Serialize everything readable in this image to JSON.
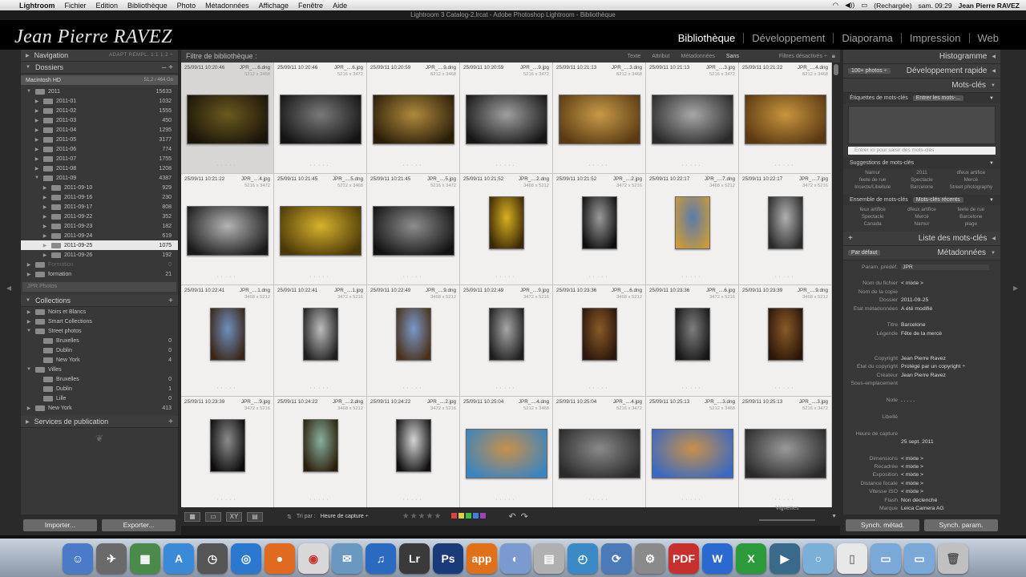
{
  "menubar": {
    "app": "Lightroom",
    "items": [
      "Fichier",
      "Edition",
      "Bibliothèque",
      "Photo",
      "Métadonnées",
      "Affichage",
      "Fenêtre",
      "Aide"
    ],
    "battery": "(Rechargée)",
    "clock": "sam. 09:29",
    "user": "Jean Pierre RAVEZ"
  },
  "window_title": "Lightroom 3 Catalog-2.lrcat - Adobe Photoshop Lightroom - Bibliothèque",
  "identity_plate": "Jean Pierre RAVEZ",
  "modules": [
    "Bibliothèque",
    "Développement",
    "Diaporama",
    "Impression",
    "Web"
  ],
  "left": {
    "navigation": {
      "title": "Navigation",
      "zoom": "ADAPT  REMPL.  1:1  1:2 ÷"
    },
    "dossiers": {
      "title": "Dossiers",
      "volume": {
        "name": "Macintosh HD",
        "size": "51,2 / 464 Go"
      },
      "folders": [
        {
          "name": "2011",
          "count": "15633",
          "level": 1,
          "open": true
        },
        {
          "name": "2011-01",
          "count": "1032",
          "level": 2
        },
        {
          "name": "2011-02",
          "count": "1555",
          "level": 2
        },
        {
          "name": "2011-03",
          "count": "450",
          "level": 2
        },
        {
          "name": "2011-04",
          "count": "1295",
          "level": 2
        },
        {
          "name": "2011-05",
          "count": "3177",
          "level": 2
        },
        {
          "name": "2011-06",
          "count": "774",
          "level": 2
        },
        {
          "name": "2011-07",
          "count": "1755",
          "level": 2
        },
        {
          "name": "2011-08",
          "count": "1208",
          "level": 2
        },
        {
          "name": "2011-09",
          "count": "4387",
          "level": 2,
          "open": true
        },
        {
          "name": "2011-09-10",
          "count": "929",
          "level": 3
        },
        {
          "name": "2011-09-16",
          "count": "230",
          "level": 3
        },
        {
          "name": "2011-09-17",
          "count": "808",
          "level": 3
        },
        {
          "name": "2011-09-22",
          "count": "352",
          "level": 3
        },
        {
          "name": "2011-09-23",
          "count": "182",
          "level": 3
        },
        {
          "name": "2011-09-24",
          "count": "619",
          "level": 3
        },
        {
          "name": "2011-09-25",
          "count": "1075",
          "level": 3,
          "selected": true
        },
        {
          "name": "2011-09-26",
          "count": "192",
          "level": 3
        },
        {
          "name": "Formation",
          "count": "0",
          "level": 1,
          "dim": true
        },
        {
          "name": "formation",
          "count": "21",
          "level": 1
        }
      ],
      "jpr": "JPR Photos"
    },
    "collections": {
      "title": "Collections",
      "items": [
        {
          "name": "Noirs et Blancs",
          "count": "",
          "level": 1
        },
        {
          "name": "Smart Collections",
          "count": "",
          "level": 1
        },
        {
          "name": "Street photos",
          "count": "",
          "level": 1,
          "open": true
        },
        {
          "name": "Bruxelles",
          "count": "0",
          "level": 2
        },
        {
          "name": "Dublin",
          "count": "0",
          "level": 2
        },
        {
          "name": "New York",
          "count": "4",
          "level": 2
        },
        {
          "name": "Villes",
          "count": "",
          "level": 1,
          "open": true
        },
        {
          "name": "Bruxelles",
          "count": "0",
          "level": 2
        },
        {
          "name": "Dublin",
          "count": "1",
          "level": 2
        },
        {
          "name": "Lille",
          "count": "0",
          "level": 2
        },
        {
          "name": "New York",
          "count": "413",
          "level": 1
        }
      ]
    },
    "publish": {
      "title": "Services de publication"
    },
    "import_label": "Importer...",
    "export_label": "Exporter..."
  },
  "filterbar": {
    "title": "Filtre de bibliothèque :",
    "options": [
      "Texte",
      "Attribut",
      "Métadonnées",
      "Sans"
    ],
    "status": "Filtres désactivés ÷"
  },
  "grid": [
    {
      "date": "25/09/11 10:20:46",
      "name": "JPR_....6.dng",
      "dims": "3472 x 5216",
      "fmt": "5212 x 3468",
      "c1": "#6b5a1e",
      "c2": "#1a140a",
      "portrait": false
    },
    {
      "date": "25/09/11 10:20:46",
      "name": "JPR_....6.jpg",
      "dims": "",
      "fmt": "5216 x 3472",
      "c1": "#7a7a7a",
      "c2": "#141414",
      "portrait": false
    },
    {
      "date": "25/09/11 10:20:59",
      "name": "JPR_....9.dng",
      "dims": "",
      "fmt": "5212 x 3468",
      "c1": "#b08a3c",
      "c2": "#2a1e0a",
      "portrait": false
    },
    {
      "date": "25/09/11 10:20:59",
      "name": "JPR_....9.jpg",
      "dims": "",
      "fmt": "5216 x 3472",
      "c1": "#a0a0a0",
      "c2": "#161616",
      "portrait": false
    },
    {
      "date": "25/09/11 10:21:13",
      "name": "JPR_....3.dng",
      "dims": "",
      "fmt": "5212 x 3468",
      "c1": "#c89a48",
      "c2": "#5a3a14",
      "portrait": false
    },
    {
      "date": "25/09/11 10:21:13",
      "name": "JPR_....3.jpg",
      "dims": "",
      "fmt": "5216 x 3472",
      "c1": "#a8a8a8",
      "c2": "#2a2a2a",
      "portrait": false
    },
    {
      "date": "25/09/11 10:21:22",
      "name": "JPR_....4.dng",
      "dims": "",
      "fmt": "5212 x 3468",
      "c1": "#c8963e",
      "c2": "#5a3812",
      "portrait": false
    },
    {
      "date": "25/09/11 10:21:22",
      "name": "JPR_....4.jpg",
      "dims": "",
      "fmt": "5216 x 3472",
      "c1": "#b4b4b4",
      "c2": "#1a1a1a",
      "portrait": false
    },
    {
      "date": "25/09/11 10:21:45",
      "name": "JPR_....5.dng",
      "dims": "",
      "fmt": "5212 x 3468",
      "c1": "#d6b22c",
      "c2": "#4a3808",
      "portrait": false
    },
    {
      "date": "25/09/11 10:21:45",
      "name": "JPR_....5.jpg",
      "dims": "",
      "fmt": "5216 x 3472",
      "c1": "#8e8e8e",
      "c2": "#121212",
      "portrait": false
    },
    {
      "date": "25/09/11 10:21:52",
      "name": "JPR_....2.dng",
      "dims": "",
      "fmt": "3468 x 5212",
      "c1": "#d8b020",
      "c2": "#3a2806",
      "portrait": true
    },
    {
      "date": "25/09/11 10:21:52",
      "name": "JPR_....2.jpg",
      "dims": "",
      "fmt": "3472 x 5216",
      "c1": "#9a9a9a",
      "c2": "#0e0e0e",
      "portrait": true
    },
    {
      "date": "25/09/11 10:22:17",
      "name": "JPR_....7.dng",
      "dims": "",
      "fmt": "3468 x 5212",
      "c1": "#5a7ab0",
      "c2": "#c89a3a",
      "portrait": true
    },
    {
      "date": "25/09/11 10:22:17",
      "name": "JPR_....7.jpg",
      "dims": "",
      "fmt": "3472 x 5216",
      "c1": "#b0b0b0",
      "c2": "#2a2a2a",
      "portrait": true
    },
    {
      "date": "25/09/11 10:22:41",
      "name": "JPR_....1.dng",
      "dims": "",
      "fmt": "3468 x 5212",
      "c1": "#6f8fc0",
      "c2": "#3a2614",
      "portrait": true
    },
    {
      "date": "25/09/11 10:22:41",
      "name": "JPR_....1.jpg",
      "dims": "",
      "fmt": "3472 x 5216",
      "c1": "#bdbdbd",
      "c2": "#1e1e1e",
      "portrait": true
    },
    {
      "date": "25/09/11 10:22:49",
      "name": "JPR_....9.dng",
      "dims": "",
      "fmt": "3468 x 5212",
      "c1": "#7a98c8",
      "c2": "#4a3018",
      "portrait": true
    },
    {
      "date": "25/09/11 10:22:49",
      "name": "JPR_....9.jpg",
      "dims": "",
      "fmt": "3472 x 5216",
      "c1": "#a6a6a6",
      "c2": "#1e1e1e",
      "portrait": true
    },
    {
      "date": "25/09/11 10:23:36",
      "name": "JPR_....6.dng",
      "dims": "",
      "fmt": "3468 x 5212",
      "c1": "#8a5a28",
      "c2": "#2a160a",
      "portrait": true
    },
    {
      "date": "25/09/11 10:23:36",
      "name": "JPR_....6.jpg",
      "dims": "",
      "fmt": "3472 x 5216",
      "c1": "#7e7e7e",
      "c2": "#161616",
      "portrait": true
    },
    {
      "date": "25/09/11 10:23:39",
      "name": "JPR_....9.dng",
      "dims": "",
      "fmt": "3468 x 5212",
      "c1": "#8a5a28",
      "c2": "#2a1608",
      "portrait": true
    },
    {
      "date": "25/09/11 10:23:39",
      "name": "JPR_....9.jpg",
      "dims": "",
      "fmt": "3472 x 5216",
      "c1": "#8c8c8c",
      "c2": "#0c0c0c",
      "portrait": true
    },
    {
      "date": "25/09/11 10:24:22",
      "name": "JPR_....2.dng",
      "dims": "",
      "fmt": "3468 x 5212",
      "c1": "#88b0a0",
      "c2": "#2a1e0a",
      "portrait": true
    },
    {
      "date": "25/09/11 10:24:22",
      "name": "JPR_....2.jpg",
      "dims": "",
      "fmt": "3472 x 5216",
      "c1": "#d4d4d4",
      "c2": "#101010",
      "portrait": true
    },
    {
      "date": "25/09/11 10:25:04",
      "name": "JPR_....4.dng",
      "dims": "",
      "fmt": "5212 x 3468",
      "c1": "#c8904a",
      "c2": "#3a84c0",
      "portrait": false
    },
    {
      "date": "25/09/11 10:25:04",
      "name": "JPR_....4.jpg",
      "dims": "",
      "fmt": "5216 x 3472",
      "c1": "#8a8a8a",
      "c2": "#2a2a2a",
      "portrait": false
    },
    {
      "date": "25/09/11 10:25:13",
      "name": "JPR_....3.dng",
      "dims": "",
      "fmt": "5212 x 3468",
      "c1": "#c8904a",
      "c2": "#3a6ac0",
      "portrait": false
    },
    {
      "date": "25/09/11 10:25:13",
      "name": "JPR_....3.jpg",
      "dims": "",
      "fmt": "5216 x 3472",
      "c1": "#9a9a9a",
      "c2": "#2a2a2a",
      "portrait": false
    }
  ],
  "toolbar": {
    "sort_label": "Tri par :",
    "sort_value": "Heure de capture ÷",
    "stars": "★★★★★",
    "colors": [
      "#e04040",
      "#e0d040",
      "#40c040",
      "#4080e0",
      "#a040c0"
    ],
    "thumb_label": "Vignettes"
  },
  "right": {
    "histogram": "Histogramme",
    "quick_dev": "Développement rapide",
    "quick_dev_dd": "100+ photos ÷",
    "keywords_title": "Mots-clés",
    "kw_tags_label": "Étiquettes de mots-clés",
    "kw_tags_dd": "Entrer les mots-...",
    "kw_input_placeholder": "Entrer ici pour saisir des mots-clés",
    "suggestions_label": "Suggestions de mots-clés",
    "suggestions": [
      "Namur",
      "2011",
      "dfeux artifice",
      "feete de rue",
      "Spectacle",
      "Mercè",
      "Incecte/Libellule",
      "Barcelone",
      "Street photography"
    ],
    "set_label": "Ensemble de mots-clés",
    "set_dd": "Mots-clés récents",
    "set_items": [
      "feux artifice",
      "dfeux artifice",
      "feete de rue",
      "Spectacle",
      "Mercè",
      "Barcelone",
      "Canada",
      "Namur",
      "plage"
    ],
    "kwlist_title": "Liste des mots-clés",
    "metadata_title": "Métadonnées",
    "meta_preset_dd": "Par défaut",
    "meta_rows": [
      {
        "k": "Param. prédéf.",
        "v": "JPR",
        "field": true
      },
      {
        "k": "",
        "v": "",
        "field": false
      },
      {
        "k": "Nom du fichier",
        "v": "< mixte >",
        "field": false
      },
      {
        "k": "Nom de la copie",
        "v": "",
        "field": false
      },
      {
        "k": "Dossier",
        "v": "2011-09-25",
        "field": false
      },
      {
        "k": "Etat métadonnées",
        "v": "A été modifié",
        "field": false
      },
      {
        "k": "",
        "v": "",
        "field": false
      },
      {
        "k": "Titre",
        "v": "Barcelone",
        "field": false
      },
      {
        "k": "Légende",
        "v": "Fête de la mercè",
        "field": false
      },
      {
        "k": "",
        "v": "",
        "field": false
      },
      {
        "k": "",
        "v": "",
        "field": false
      },
      {
        "k": "Copyright",
        "v": "Jean Pierre Ravez",
        "field": false
      },
      {
        "k": "Etat du copyright",
        "v": "Protégé par un copyright ÷",
        "field": false
      },
      {
        "k": "Créateur",
        "v": "Jean Pierre Ravez",
        "field": false
      },
      {
        "k": "Sous-emplacement",
        "v": "",
        "field": true
      },
      {
        "k": "",
        "v": "",
        "field": false
      },
      {
        "k": "Note",
        "v": ". . . . .",
        "field": false
      },
      {
        "k": "",
        "v": "",
        "field": false
      },
      {
        "k": "Libellé",
        "v": "",
        "field": true
      },
      {
        "k": "",
        "v": "",
        "field": false
      },
      {
        "k": "Heure de capture",
        "v": "",
        "field": false
      },
      {
        "k": "",
        "v": "25 sept. 2011",
        "field": false
      },
      {
        "k": "",
        "v": "",
        "field": false
      },
      {
        "k": "Dimensions",
        "v": "< mixte >",
        "field": false
      },
      {
        "k": "Recadrée",
        "v": "< mixte >",
        "field": false
      },
      {
        "k": "Exposition",
        "v": "< mixte >",
        "field": false
      },
      {
        "k": "Distance focale",
        "v": "< mixte >",
        "field": false
      },
      {
        "k": "Vitesse ISO",
        "v": "< mixte >",
        "field": false
      },
      {
        "k": "Flash",
        "v": "Non déclenché",
        "field": false
      },
      {
        "k": "Marque",
        "v": "Leica Camera AG",
        "field": false
      }
    ],
    "sync_meta": "Synch. métad.",
    "sync_params": "Synch. param."
  }
}
